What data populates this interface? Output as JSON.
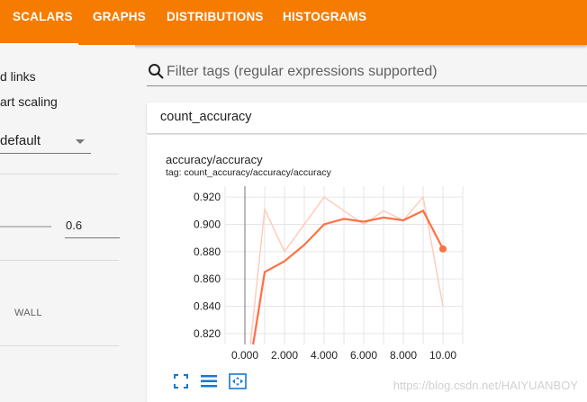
{
  "nav": {
    "tabs": [
      {
        "label": "SCALARS",
        "active": true
      },
      {
        "label": "GRAPHS",
        "active": false
      },
      {
        "label": "DISTRIBUTIONS",
        "active": false
      },
      {
        "label": "HISTOGRAMS",
        "active": false
      }
    ],
    "bar_color": "#f57c00"
  },
  "sidebar": {
    "links_label": "d links",
    "scaling_label": "art scaling",
    "tooltip_sort_value": "default",
    "smoothing_value": "0.6",
    "wall_label": "WALL"
  },
  "search": {
    "placeholder": "Filter tags (regular expressions supported)",
    "icon": "search-icon"
  },
  "group": {
    "name": "count_accuracy"
  },
  "card": {
    "title": "accuracy/accuracy",
    "tag": "tag: count_accuracy/accuracy/accuracy",
    "controls": [
      "fullscreen-icon",
      "toggle-log-scale-icon",
      "fit-domain-icon"
    ]
  },
  "watermark": "https://blog.csdn.net/HAIYUANBOY",
  "chart_data": {
    "type": "line",
    "x": [
      0,
      1,
      2,
      3,
      4,
      5,
      6,
      7,
      8,
      9,
      10
    ],
    "xticks": [
      "0.000",
      "2.000",
      "4.000",
      "6.000",
      "8.000",
      "10.00"
    ],
    "yticks": [
      "0.820",
      "0.840",
      "0.860",
      "0.880",
      "0.900",
      "0.920"
    ],
    "xlim": [
      -1,
      11
    ],
    "ylim": [
      0.812,
      0.928
    ],
    "grid": true,
    "series": [
      {
        "values": [
          0.774,
          0.911,
          0.88,
          0.9,
          0.92,
          0.91,
          0.9,
          0.91,
          0.903,
          0.92,
          0.84
        ],
        "color": "#ffccbc",
        "smoothed": false
      },
      {
        "values": [
          0.774,
          0.865,
          0.873,
          0.885,
          0.9,
          0.904,
          0.902,
          0.905,
          0.903,
          0.91,
          0.882
        ],
        "color": "#ff7043",
        "smoothed": true
      }
    ]
  }
}
